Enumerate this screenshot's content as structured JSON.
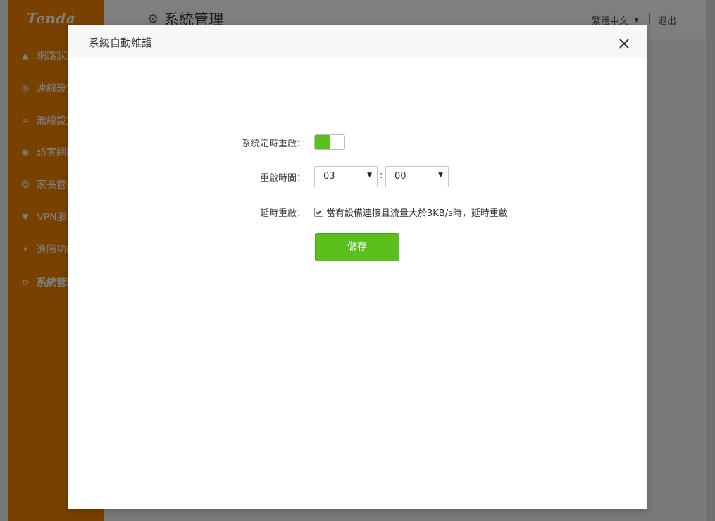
{
  "app": {
    "logo": "Tenda",
    "page_title": "系統管理",
    "language": "繁體中文",
    "logout": "退出"
  },
  "sidebar": {
    "items": [
      {
        "label": "網路狀態",
        "icon": "network-status-icon"
      },
      {
        "label": "連線設定",
        "icon": "globe-icon"
      },
      {
        "label": "無線設定",
        "icon": "wifi-icon"
      },
      {
        "label": "訪客網路",
        "icon": "guest-icon"
      },
      {
        "label": "家長管控",
        "icon": "parental-icon"
      },
      {
        "label": "VPN服務",
        "icon": "vpn-icon"
      },
      {
        "label": "進階功能",
        "icon": "wrench-icon"
      },
      {
        "label": "系統管理",
        "icon": "gear-icon",
        "active": true
      }
    ]
  },
  "modal": {
    "title": "系統自動維護",
    "close_icon": "close-icon",
    "schedule_label": "系統定時重啟：",
    "schedule_enabled": true,
    "time_label": "重啟時間：",
    "hour": "03",
    "minute": "00",
    "time_separator": ":",
    "delay_label": "延時重啟：",
    "delay_checked": true,
    "delay_text": "當有設備連接且流量大於3KB/s時，延時重啟",
    "save_label": "儲存"
  },
  "colors": {
    "sidebar": "#f08300",
    "accent_green": "#5bbf1e"
  }
}
